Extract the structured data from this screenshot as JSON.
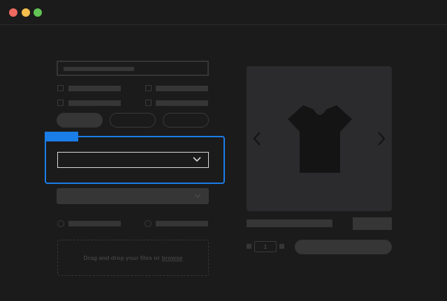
{
  "window": {
    "controls": [
      "close",
      "minimize",
      "zoom"
    ],
    "colors": {
      "close": "#ee6a5f",
      "minimize": "#f5be4f",
      "zoom": "#61c454",
      "accent": "#1a7de8"
    }
  },
  "form": {
    "focused_element": "select-dropdown",
    "upload": {
      "text": "Drag and drop your files or",
      "link": "browse"
    }
  },
  "product": {
    "image_icon": "tshirt-icon",
    "quantity": "1"
  }
}
